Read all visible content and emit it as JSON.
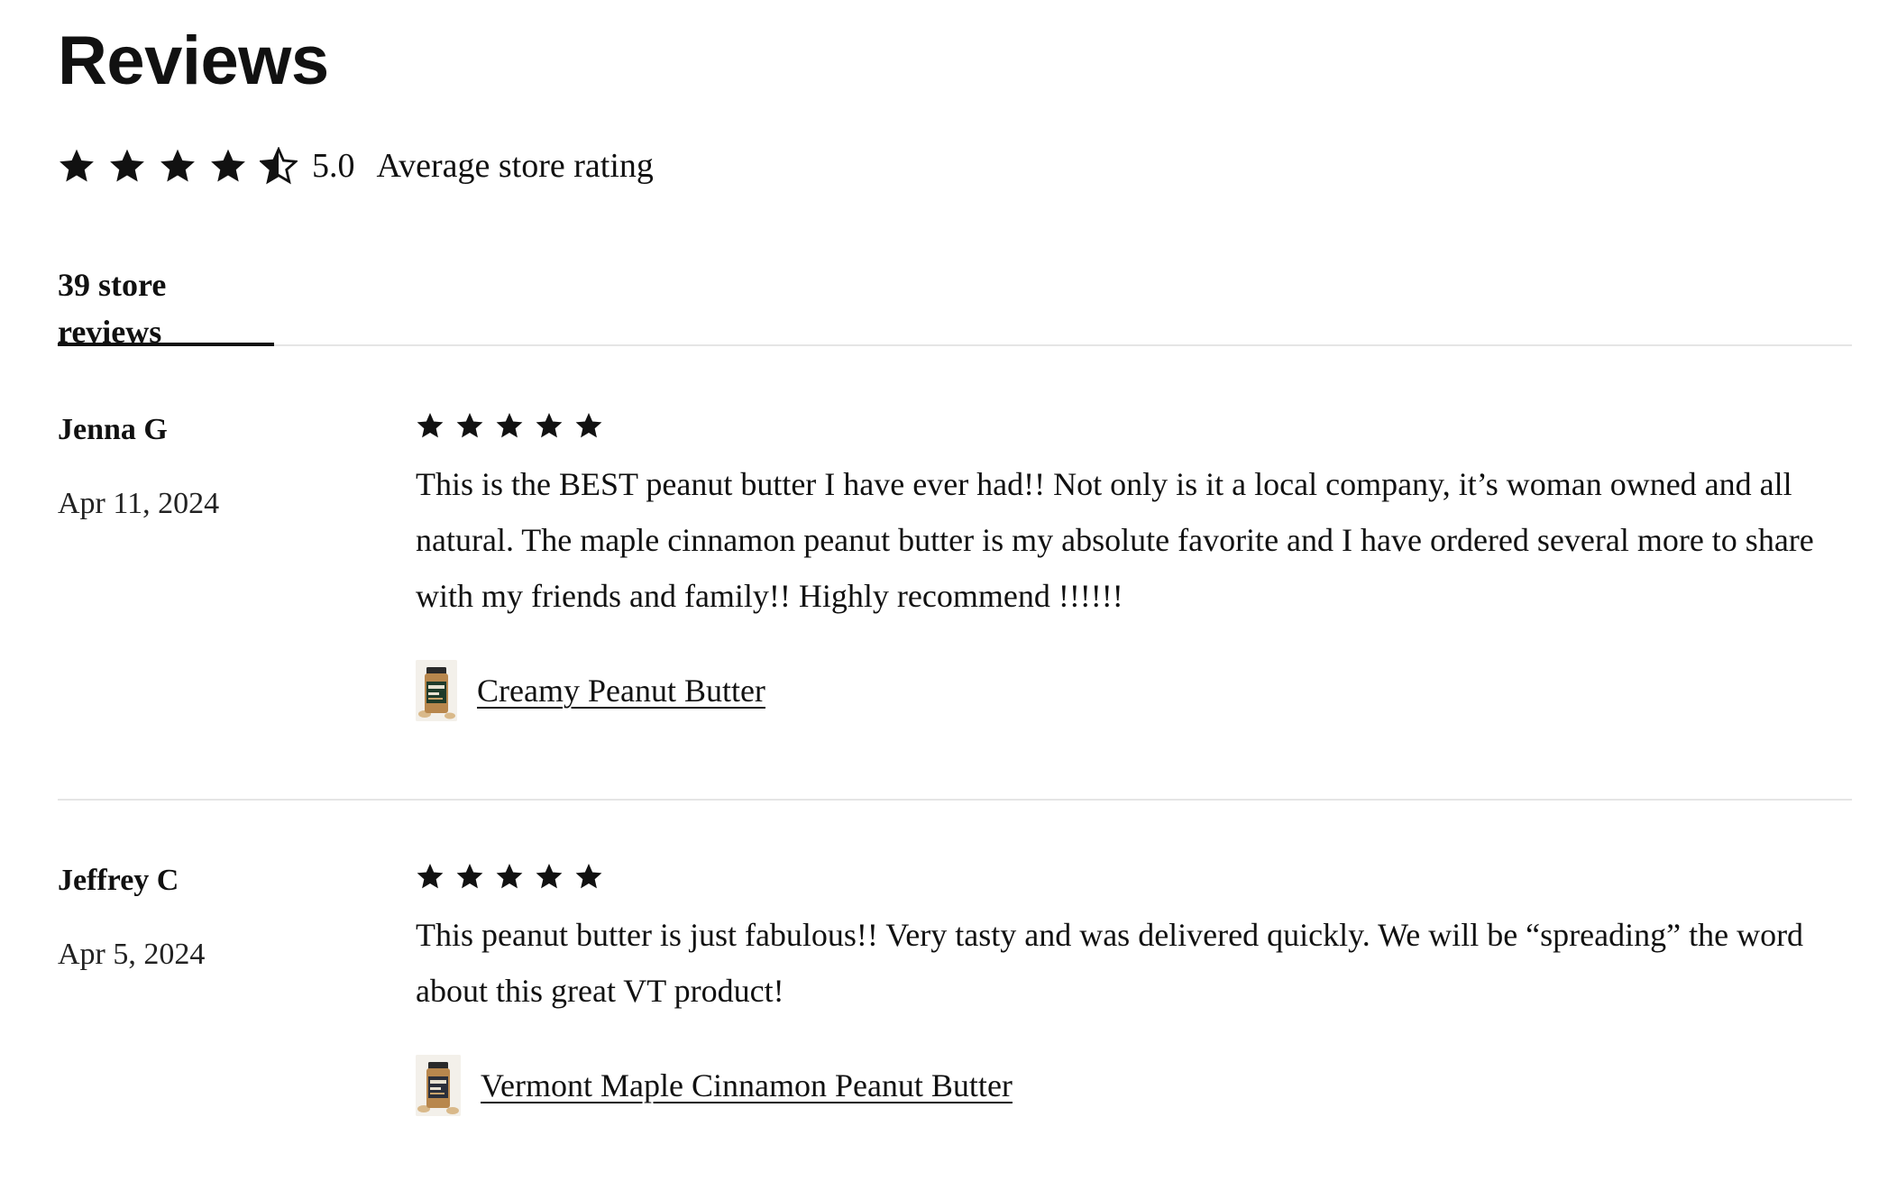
{
  "header": {
    "title": "Reviews"
  },
  "summary": {
    "rating": 4.5,
    "rating_display": "5.0",
    "label": "Average store rating"
  },
  "tabs": [
    {
      "label": "39 store reviews",
      "active": true
    }
  ],
  "reviews": [
    {
      "reviewer": "Jenna G",
      "date": "Apr 11, 2024",
      "rating": 5,
      "text": "This is the BEST peanut butter I have ever had!! Not only is it a local company, it’s woman owned and all natural. The maple cinnamon peanut butter is my absolute favorite and I have ordered several more to share with my friends and family!! Highly recommend !!!!!!",
      "product": "Creamy Peanut Butter"
    },
    {
      "reviewer": "Jeffrey C",
      "date": "Apr 5, 2024",
      "rating": 5,
      "text": "This peanut butter is just fabulous!! Very tasty and was delivered quickly. We will be “spreading” the word about this great VT product!",
      "product": "Vermont Maple Cinnamon Peanut Butter"
    }
  ],
  "colors": {
    "text": "#111111",
    "divider": "#e5e5e5",
    "star": "#111111"
  }
}
